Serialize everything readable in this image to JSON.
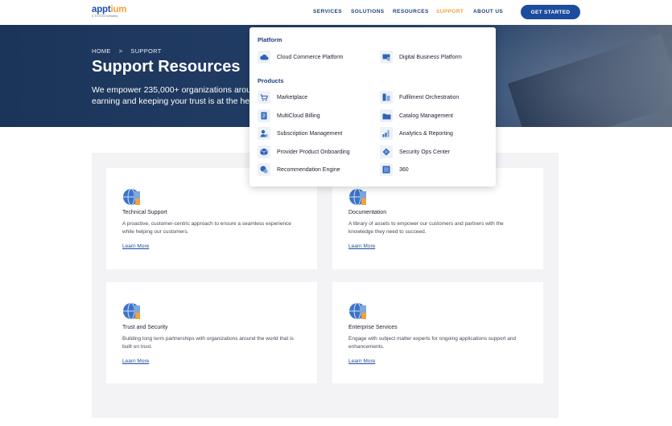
{
  "header": {
    "logo_main": "apptium",
    "logo_sub": "A TOTOGI company",
    "nav": [
      "SERVICES",
      "SOLUTIONS",
      "RESOURCES",
      "SUPPORT",
      "ABOUT US"
    ],
    "cta_label": "GET STARTED"
  },
  "hero": {
    "breadcrumb_home": "HOME",
    "breadcrumb_sep": ">",
    "breadcrumb_current": "SUPPORT",
    "title": "Support Resources",
    "desc_line1": "We empower 235,000+ organizations arou",
    "desc_line2": "earning and keeping your trust is at the he"
  },
  "dropdown": {
    "platform_heading": "Platform",
    "platform_items": [
      "Cloud Commerce Platform",
      "Digital Business Platform"
    ],
    "products_heading": "Products",
    "product_items": [
      "Marketplace",
      "Fulfilment Orchestration",
      "MultiCloud Billing",
      "Catalog Management",
      "Subscription Management",
      "Analytics & Reporting",
      "Provider Product Onboarding",
      "Security Ops Center",
      "Recommendation Engine",
      "360"
    ]
  },
  "cards": [
    {
      "title": "Technical Support",
      "desc": "A proactive, customer-centric approach to ensure a seamless experience  while helping our customers.",
      "link": "Learn More"
    },
    {
      "title": "Documentation",
      "desc": "A library of assets to empower our customers and partners with the knowledge they need to succeed.",
      "link": "Learn More"
    },
    {
      "title": "Trust and Security",
      "desc": "Building long term partnerships with organizations around the world that is built on trust.",
      "link": "Learn More"
    },
    {
      "title": "Enterprise Services",
      "desc": "Engage with subject matter experts for ongoing applications support and enhancements.",
      "link": "Learn More"
    }
  ],
  "colors": {
    "brand_blue": "#1d4c9c",
    "accent_orange": "#f2a23a",
    "hero_bg": "#223d66"
  }
}
